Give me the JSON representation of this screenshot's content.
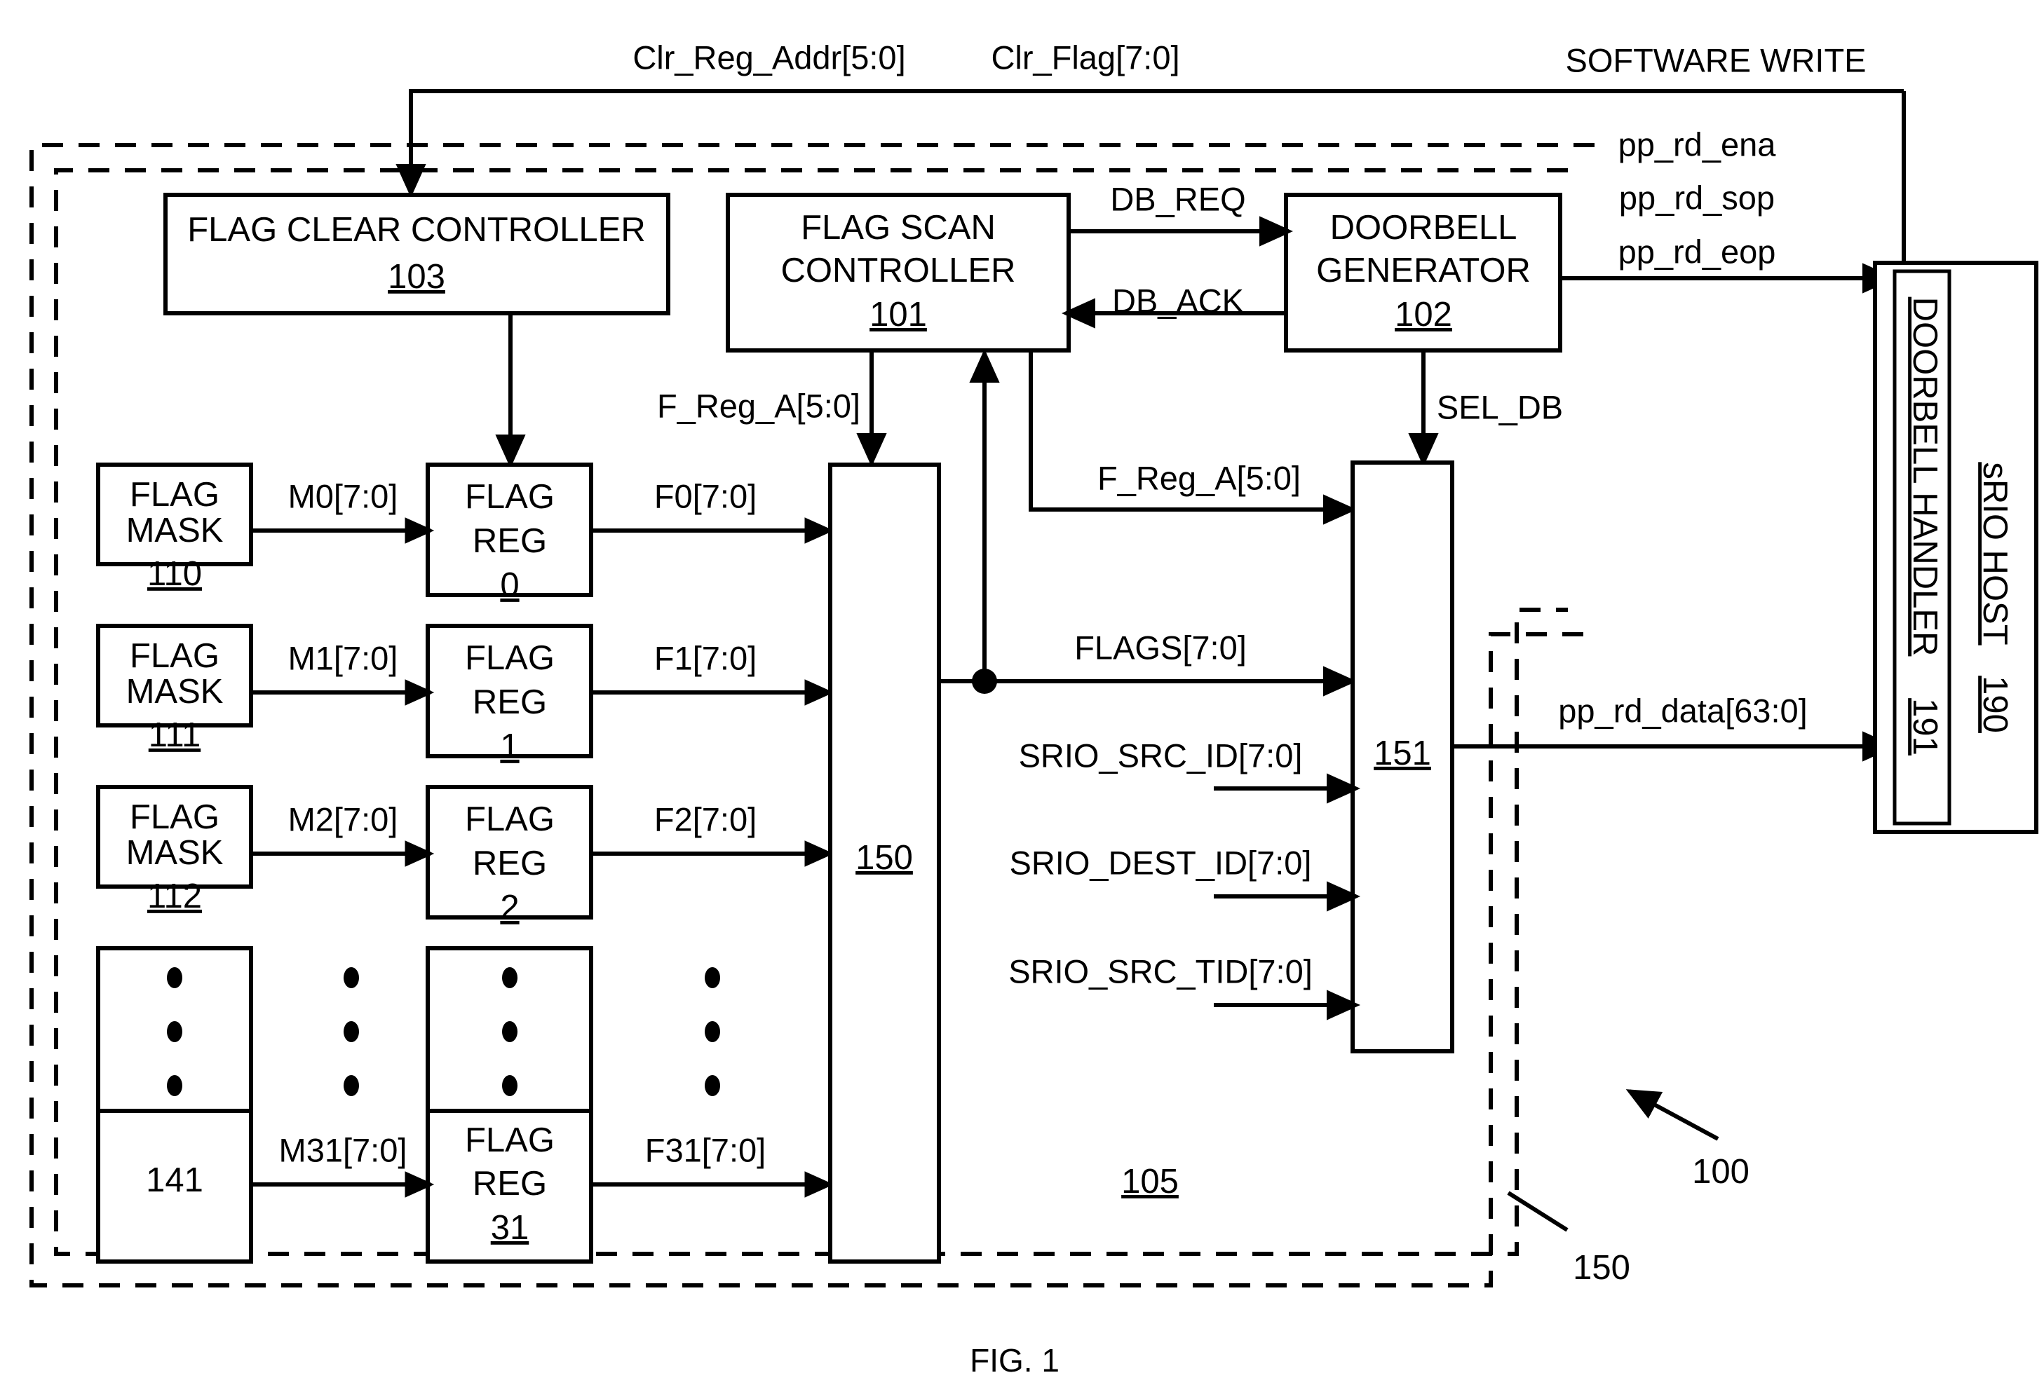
{
  "figure": {
    "caption": "FIG. 1",
    "top_labels": {
      "clr_reg_addr": "Clr_Reg_Addr[5:0]",
      "clr_flag": "Clr_Flag[7:0]",
      "software_write": "SOFTWARE WRITE"
    }
  },
  "blocks": {
    "flag_clear_controller": {
      "title": "FLAG CLEAR CONTROLLER",
      "ref": "103"
    },
    "flag_scan_controller": {
      "title_line1": "FLAG SCAN",
      "title_line2": "CONTROLLER",
      "ref": "101"
    },
    "doorbell_generator": {
      "title_line1": "DOORBELL",
      "title_line2": "GENERATOR",
      "ref": "102"
    },
    "mux_150": {
      "ref": "150"
    },
    "mux_151": {
      "ref": "151"
    },
    "doorbell_handler": {
      "title": "DOORBELL HANDLER",
      "ref": "191"
    },
    "srio_host": {
      "title": "sRIO HOST",
      "ref": "190"
    }
  },
  "flag_masks": [
    {
      "line1": "FLAG",
      "line2": "MASK",
      "ref": "110"
    },
    {
      "line1": "FLAG",
      "line2": "MASK",
      "ref": "111"
    },
    {
      "line1": "FLAG",
      "line2": "MASK",
      "ref": "112"
    },
    {
      "line1": "",
      "line2": "141",
      "ref": ""
    }
  ],
  "flag_mask_group_ref": "141",
  "flag_regs": [
    {
      "line1": "FLAG",
      "line2": "REG",
      "ref": "0"
    },
    {
      "line1": "FLAG",
      "line2": "REG",
      "ref": "1"
    },
    {
      "line1": "FLAG",
      "line2": "REG",
      "ref": "2"
    },
    {
      "line1": "FLAG",
      "line2": "REG",
      "ref": "31"
    }
  ],
  "mask_signals": [
    "M0[7:0]",
    "M1[7:0]",
    "M2[7:0]",
    "M31[7:0]"
  ],
  "flag_signals": [
    "F0[7:0]",
    "F1[7:0]",
    "F2[7:0]",
    "F31[7:0]"
  ],
  "signals": {
    "db_req": "DB_REQ",
    "db_ack": "DB_ACK",
    "sel_db": "SEL_DB",
    "f_reg_a_left": "F_Reg_A[5:0]",
    "f_reg_a_right": "F_Reg_A[5:0]",
    "flags": "FLAGS[7:0]",
    "srio_src_id": "SRIO_SRC_ID[7:0]",
    "srio_dest_id": "SRIO_DEST_ID[7:0]",
    "srio_src_tid": "SRIO_SRC_TID[7:0]",
    "pp_rd_ena": "pp_rd_ena",
    "pp_rd_sop": "pp_rd_sop",
    "pp_rd_eop": "pp_rd_eop",
    "pp_rd_data": "pp_rd_data[63:0]"
  },
  "callouts": {
    "ref_105": "105",
    "ref_100": "100",
    "ref_150_outer": "150"
  }
}
